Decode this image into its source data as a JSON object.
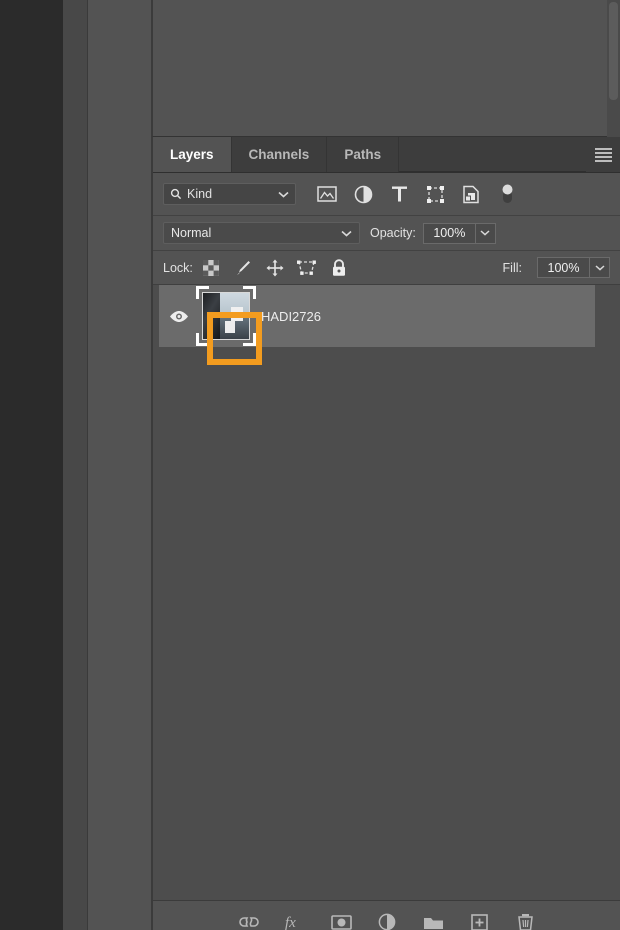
{
  "panel": {
    "tabs": [
      {
        "label": "Layers",
        "active": true
      },
      {
        "label": "Channels",
        "active": false
      },
      {
        "label": "Paths",
        "active": false
      }
    ],
    "menu_icon": "hamburger-menu-icon"
  },
  "filter": {
    "kind_label": "Kind",
    "search_icon": "search-icon",
    "chevron": "chevron-down-icon",
    "icons": [
      "pixel-layer-filter-icon",
      "adjustment-layer-filter-icon",
      "type-layer-filter-icon",
      "shape-layer-filter-icon",
      "smart-object-filter-icon",
      "filter-toggle-switch-icon"
    ]
  },
  "blend": {
    "mode": "Normal",
    "opacity_label": "Opacity:",
    "opacity_value": "100%",
    "chevron": "chevron-down-icon"
  },
  "lock": {
    "label": "Lock:",
    "icons": [
      "lock-transparent-pixels-icon",
      "lock-image-pixels-icon",
      "lock-position-icon",
      "lock-nesting-icon",
      "lock-all-icon"
    ],
    "fill_label": "Fill:",
    "fill_value": "100%"
  },
  "layers": [
    {
      "name": "HADI2726",
      "visible": true,
      "selected": true,
      "visibility_icon": "eye-icon",
      "thumbnail": "smart-object-thumbnail"
    }
  ],
  "annotation": {
    "color": "#F39C1F",
    "target": "layer-thumbnail"
  },
  "bottom_toolbar": {
    "icons": [
      "link-layers-icon",
      "layer-style-fx-icon",
      "add-layer-mask-icon",
      "new-adjustment-layer-icon",
      "new-group-icon",
      "new-layer-icon",
      "delete-layer-icon"
    ]
  },
  "colors": {
    "panel_bg": "#535353",
    "list_bg": "#4d4d4d",
    "tab_inactive_bg": "#3d3d3d",
    "row_selected": "#6b6b6b",
    "annotation": "#F39C1F"
  }
}
